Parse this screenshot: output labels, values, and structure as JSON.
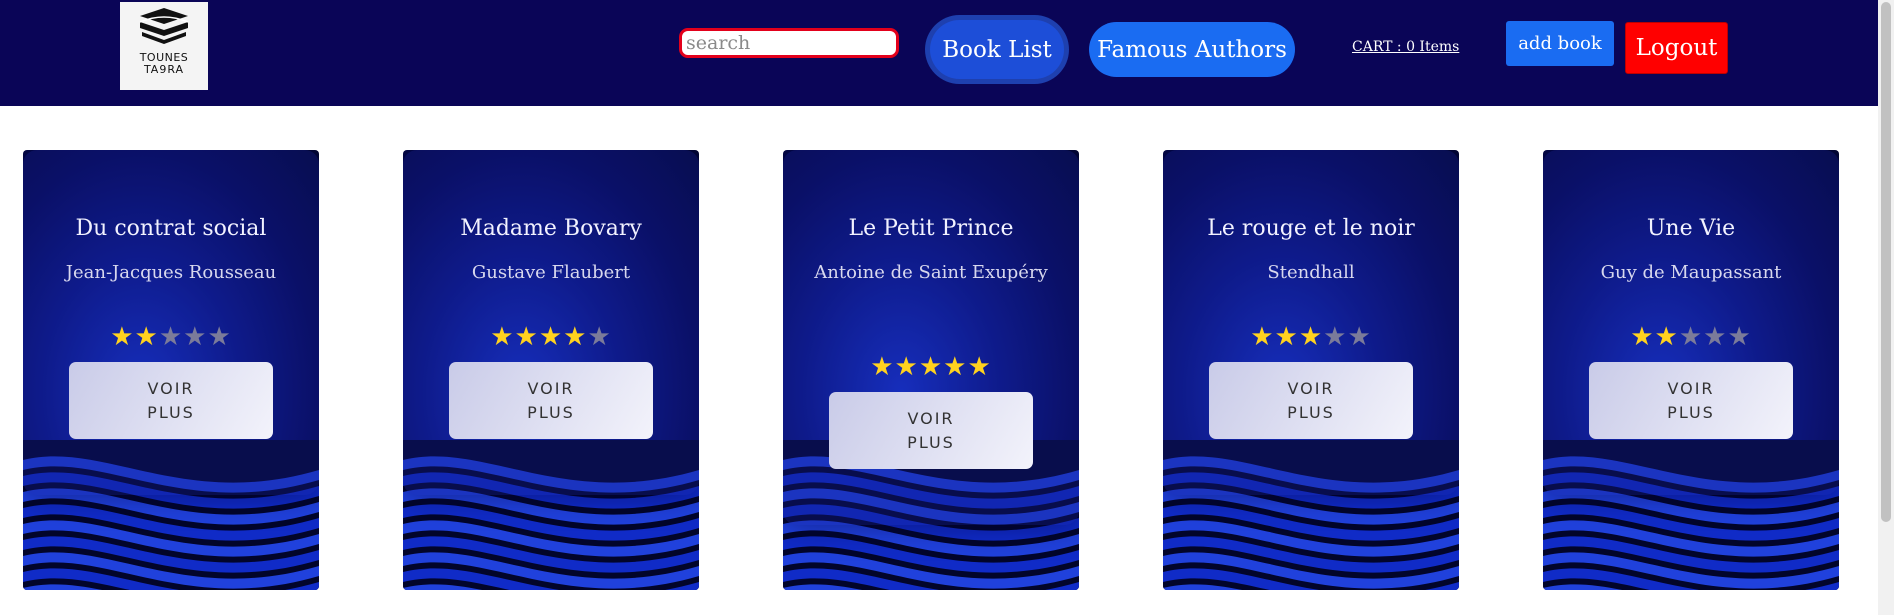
{
  "navbar": {
    "logo": {
      "line1": "TOUNES",
      "line2": "TA9RA"
    },
    "search": {
      "placeholder": "search",
      "value": ""
    },
    "book_list_label": "Book List",
    "famous_authors_label": "Famous Authors",
    "cart_label": "CART : 0 Items",
    "add_book_label": "add book",
    "logout_label": "Logout",
    "colors": {
      "bar": "#0a0557",
      "primary": "#1a6cf2",
      "logout": "#ff0000",
      "search_border": "#e3001b"
    }
  },
  "books": [
    {
      "title": "Du contrat social",
      "author": "Jean-Jacques Rousseau",
      "rating": 2,
      "max_rating": 5,
      "button_label": "VOIR PLUS"
    },
    {
      "title": "Madame Bovary",
      "author": "Gustave Flaubert",
      "rating": 4,
      "max_rating": 5,
      "button_label": "VOIR PLUS"
    },
    {
      "title": "Le Petit Prince",
      "author": "Antoine de Saint Exupéry",
      "rating": 5,
      "max_rating": 5,
      "button_label": "VOIR PLUS"
    },
    {
      "title": "Le rouge et le noir",
      "author": "Stendhall",
      "rating": 3,
      "max_rating": 5,
      "button_label": "VOIR PLUS"
    },
    {
      "title": "Une Vie",
      "author": "Guy de Maupassant",
      "rating": 2,
      "max_rating": 5,
      "button_label": "VOIR PLUS"
    }
  ],
  "icons": {
    "star_filled": "star-icon",
    "star_empty": "star-empty-icon",
    "logo": "book-logo-icon"
  }
}
